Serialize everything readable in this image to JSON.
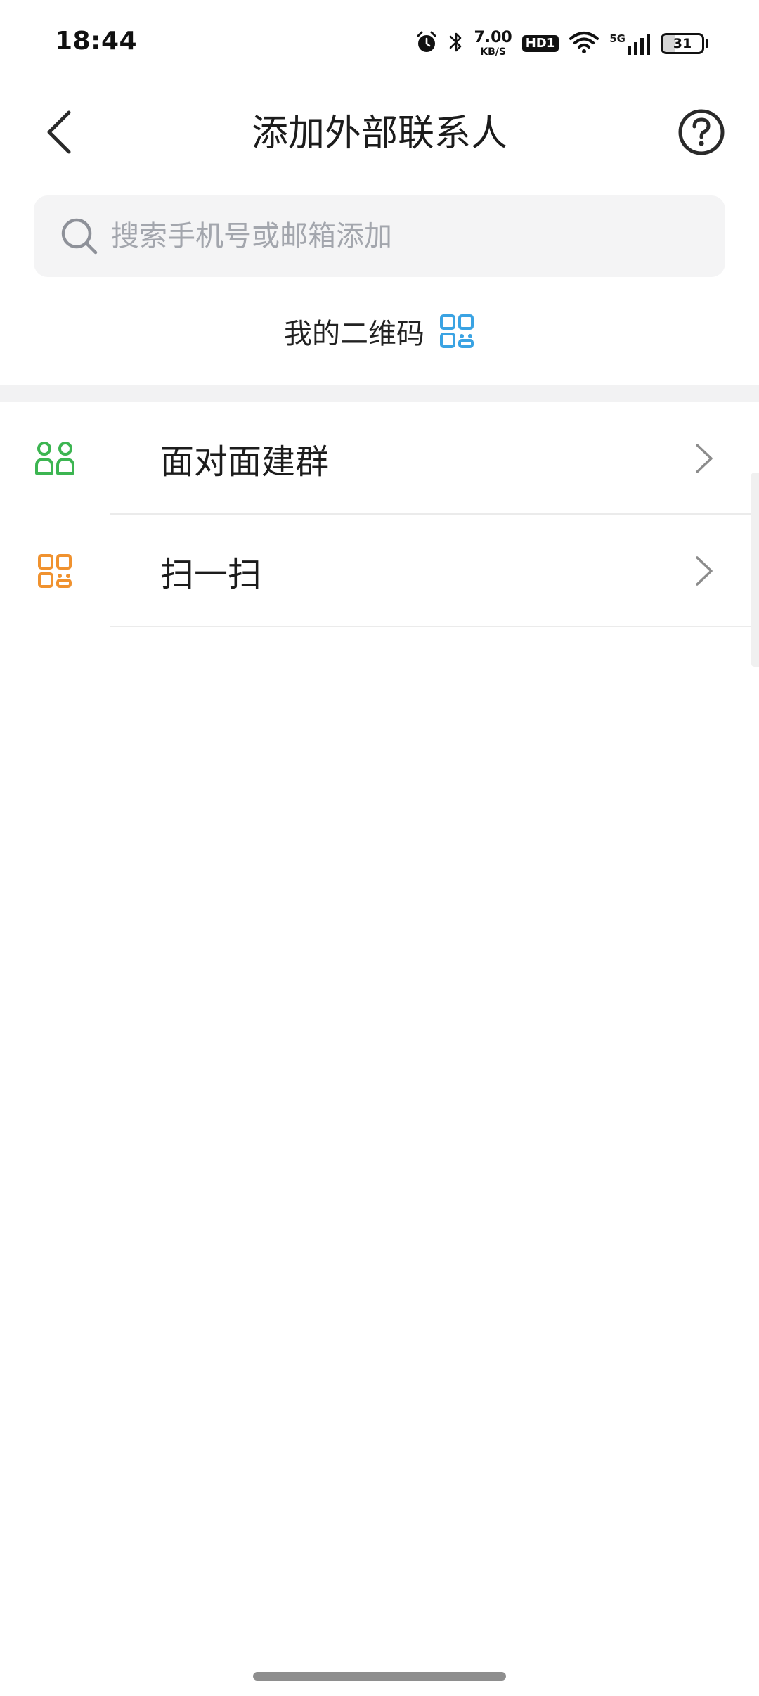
{
  "status_bar": {
    "time": "18:44",
    "net_speed_value": "7.00",
    "net_speed_unit": "KB/S",
    "hd_label": "HD1",
    "network_label": "5G",
    "battery_level": "31",
    "icons": [
      "alarm-icon",
      "bluetooth-icon",
      "wifi-icon",
      "signal-icon",
      "battery-icon"
    ]
  },
  "header": {
    "title": "添加外部联系人",
    "back_icon": "chevron-left-icon",
    "help_icon": "question-circle-icon"
  },
  "search": {
    "placeholder": "搜索手机号或邮箱添加",
    "value": ""
  },
  "my_qr": {
    "label": "我的二维码",
    "icon": "qr-code-icon",
    "icon_color": "#3aa3e3"
  },
  "menu": {
    "items": [
      {
        "label": "面对面建群",
        "icon": "group-icon",
        "icon_color": "#3cb551"
      },
      {
        "label": "扫一扫",
        "icon": "scan-icon",
        "icon_color": "#f0922f"
      }
    ]
  }
}
